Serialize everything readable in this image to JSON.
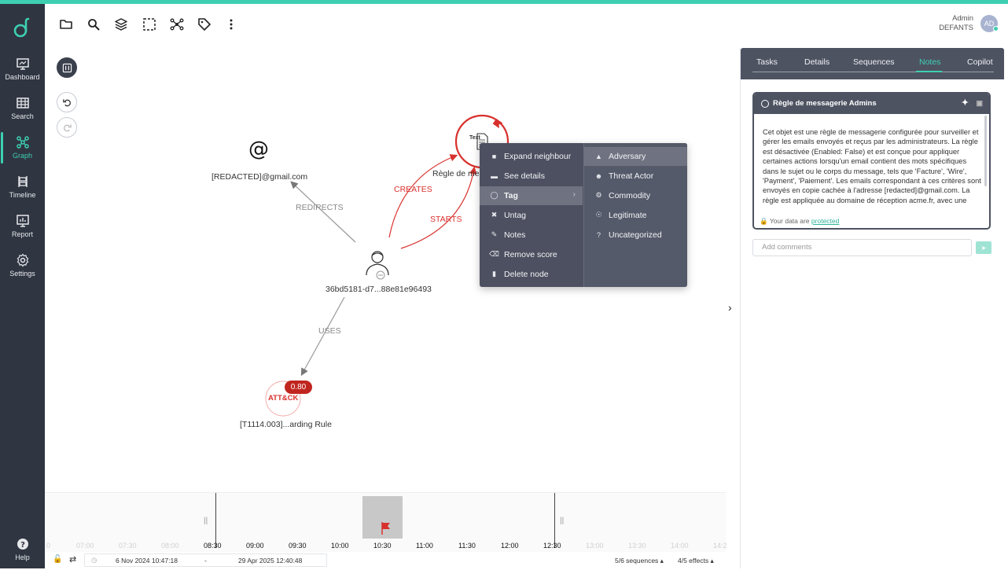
{
  "sidebar": {
    "items": [
      {
        "label": "Dashboard",
        "icon": "monitor-icon"
      },
      {
        "label": "Search",
        "icon": "table-icon"
      },
      {
        "label": "Graph",
        "icon": "graph-icon",
        "active": true
      },
      {
        "label": "Timeline",
        "icon": "timeline-icon"
      },
      {
        "label": "Report",
        "icon": "report-icon"
      },
      {
        "label": "Settings",
        "icon": "gear-icon"
      }
    ],
    "help_label": "Help"
  },
  "header": {
    "user_name": "Admin",
    "user_org": "DEFANTS",
    "avatar_initials": "AD"
  },
  "graph": {
    "edges": {
      "redirects": "REDIRECTS",
      "creates": "CREATES",
      "starts": "STARTS",
      "uses": "USES"
    },
    "nodes": {
      "email_glyph": "@",
      "email": "[REDACTED]@gmail.com",
      "rule_text": "Text",
      "rule": "Règle de me",
      "user": "36bd5181-d7...88e81e96493",
      "attack_badge": "ATT&CK",
      "attack_score": "0.80",
      "attack": "[T1114.003]...arding Rule"
    }
  },
  "context_menu": {
    "items": [
      {
        "label": "Expand neighbour",
        "icon": "expand-icon"
      },
      {
        "label": "See details",
        "icon": "details-icon"
      },
      {
        "label": "Tag",
        "icon": "tag-icon"
      },
      {
        "label": "Untag",
        "icon": "untag-icon"
      },
      {
        "label": "Notes",
        "icon": "notes-icon"
      },
      {
        "label": "Remove score",
        "icon": "eraser-icon"
      },
      {
        "label": "Delete node",
        "icon": "trash-icon"
      }
    ],
    "submenu": [
      {
        "label": "Adversary",
        "icon": "warning-icon"
      },
      {
        "label": "Threat Actor",
        "icon": "actor-icon"
      },
      {
        "label": "Commodity",
        "icon": "commodity-icon"
      },
      {
        "label": "Legitimate",
        "icon": "check-icon"
      },
      {
        "label": "Uncategorized",
        "icon": "question-icon"
      }
    ]
  },
  "panel": {
    "tabs": [
      "Tasks",
      "Details",
      "Sequences",
      "Notes",
      "Copilot"
    ],
    "active_tab": "Notes",
    "note_title": "Règle de messagerie Admins",
    "note_body": "Cet objet est une règle de messagerie configurée pour surveiller et gérer les emails envoyés et reçus par les administrateurs. La règle est désactivée (Enabled: False) et est conçue pour appliquer certaines actions lorsqu'un email contient des mots spécifiques dans le sujet ou le corps du message, tels que 'Facture', 'Wire', 'Payment', 'Paiement'. Les emails correspondant à ces critères sont envoyés en copie cachée à l'adresse [redacted]@gmail.com. La règle est appliquée au domaine de réception acme.fr, avec une",
    "footer_text": "Your data are",
    "footer_link": "protected",
    "comment_placeholder": "Add comments"
  },
  "timeline": {
    "ticks": [
      "0",
      "07:00",
      "07:30",
      "08:00",
      "08:30",
      "09:00",
      "09:30",
      "10:00",
      "10:30",
      "11:00",
      "11:30",
      "12:00",
      "12:30",
      "13:00",
      "13:30",
      "14:00",
      "14:2"
    ],
    "start_date": "6 Nov 2024 10:47:18",
    "separator": "-",
    "end_date": "29 Apr 2025 12:40:48",
    "sequences": "5/6 sequences",
    "effects": "4/5 effects"
  },
  "colors": {
    "accent": "#3ecfb2",
    "sidebar": "#2f3541",
    "danger": "#d8312d",
    "menu": "#4c5060"
  }
}
